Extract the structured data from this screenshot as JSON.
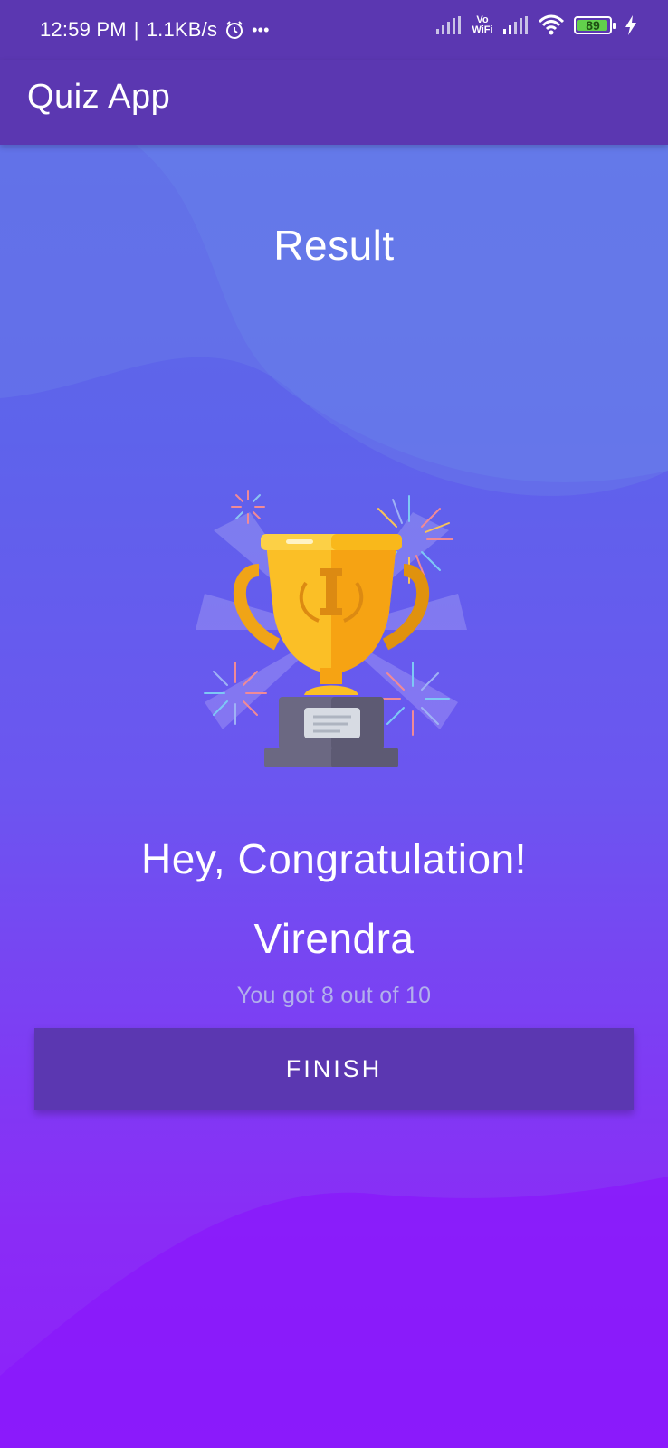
{
  "status_bar": {
    "time": "12:59 PM",
    "speed": "1.1KB/s",
    "more": "•••",
    "vowifi_top": "Vo",
    "vowifi_bottom": "WiFi",
    "battery": "89",
    "icons": [
      "alarm-icon",
      "signal-icon",
      "vowifi-icon",
      "signal-icon",
      "wifi-icon",
      "battery-icon",
      "charging-icon"
    ]
  },
  "app_bar": {
    "title": "Quiz App"
  },
  "result": {
    "heading": "Result",
    "congrats": "Hey, Congratulation!",
    "name": "Virendra",
    "score_text": "You got 8 out of 10",
    "button_label": "FINISH"
  },
  "colors": {
    "app_bar": "#5b37b1",
    "button": "#5b37b1",
    "bg_top": "#5b6ee6",
    "bg_bottom": "#8e1ffb",
    "trophy_gold": "#f9b81b",
    "trophy_base": "#5d5a73"
  }
}
